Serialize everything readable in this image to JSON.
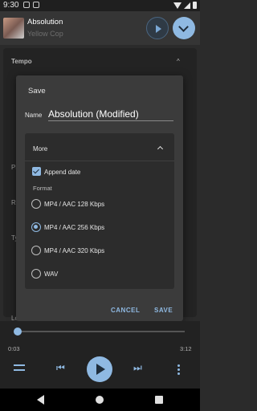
{
  "status_bar": {
    "time": "9:30"
  },
  "now_playing": {
    "title": "Absolution",
    "artist": "Yellow Cop"
  },
  "background": {
    "section_tempo": "Tempo",
    "letters": [
      "Pi",
      "Ra",
      "Ty",
      "Lo"
    ]
  },
  "save_dialog": {
    "title": "Save",
    "name_label": "Name",
    "name_value": "Absolution (Modified)",
    "more": {
      "title": "More",
      "append_date_label": "Append date",
      "append_date_checked": true,
      "format_label": "Format",
      "formats": [
        {
          "label": "MP4 / AAC 128 Kbps",
          "selected": false
        },
        {
          "label": "MP4 / AAC 256 Kbps",
          "selected": true
        },
        {
          "label": "MP4 / AAC 320 Kbps",
          "selected": false
        },
        {
          "label": "WAV",
          "selected": false
        }
      ]
    },
    "cancel_label": "CANCEL",
    "save_label": "SAVE"
  },
  "player": {
    "elapsed": "0:03",
    "duration": "3:12",
    "progress_fraction": 0.016
  },
  "colors": {
    "accent": "#8fb9e2",
    "dialog_bg": "#3b3b3b",
    "card_bg": "#2c2c2c"
  }
}
